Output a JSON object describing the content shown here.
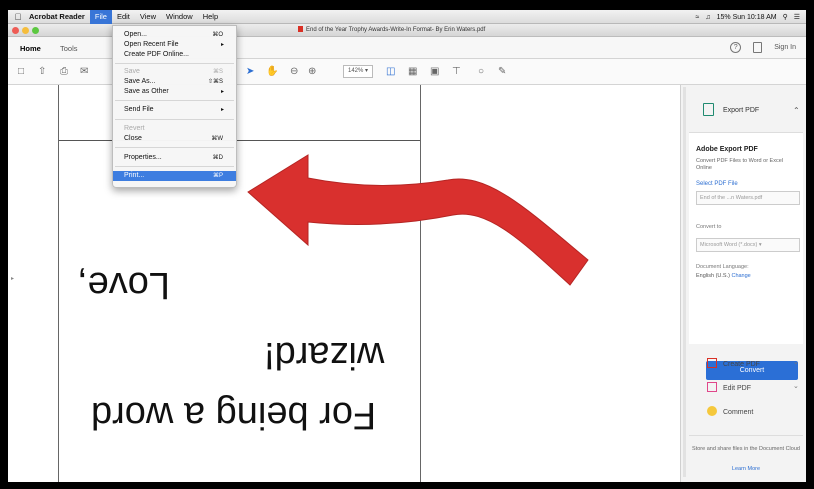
{
  "menubar": {
    "app": "Acrobat Reader",
    "items": [
      "File",
      "Edit",
      "View",
      "Window",
      "Help"
    ],
    "active": "File",
    "status": "15% Sun 10:18 AM"
  },
  "window": {
    "doc_title": "End of the Year Trophy Awards-Write-In Format- By Erin Waters.pdf"
  },
  "app_tabs": {
    "home": "Home",
    "tools": "Tools",
    "help_icon": "?",
    "sign_in": "Sign In"
  },
  "toolbar": {
    "zoom": "142%"
  },
  "file_menu": {
    "items": [
      {
        "label": "Open...",
        "shortcut": "⌘O"
      },
      {
        "label": "Open Recent File",
        "submenu": "▸"
      },
      {
        "label": "Create PDF Online..."
      },
      {
        "label": "Save",
        "shortcut": "⌘S",
        "disabled": true
      },
      {
        "label": "Save As...",
        "shortcut": "⇧⌘S"
      },
      {
        "label": "Save as Other",
        "submenu": "▸"
      },
      {
        "label": "Send File",
        "submenu": "▸"
      },
      {
        "label": "Revert",
        "disabled": true
      },
      {
        "label": "Close",
        "shortcut": "⌘W"
      },
      {
        "label": "Properties...",
        "shortcut": "⌘D"
      },
      {
        "label": "Print...",
        "shortcut": "⌘P",
        "highlighted": true
      }
    ]
  },
  "document": {
    "line1": "Love,",
    "line2": "wizard!",
    "line3": "For being a word"
  },
  "right_panel": {
    "export_header": "Export PDF",
    "card_title": "Adobe Export PDF",
    "card_desc": "Convert PDF Files to Word or Excel Online",
    "select_label": "Select PDF File",
    "file_field": "End of the ...n Waters.pdf",
    "convert_to_label": "Convert to",
    "convert_to_value": "Microsoft Word (*.docx)",
    "doc_lang_label": "Document Language:",
    "doc_lang_value": "English (U.S.)",
    "change_link": "Change",
    "convert_button": "Convert",
    "tools": [
      "Create PDF",
      "Edit PDF",
      "Comment"
    ],
    "cloud_text": "Store and share files in the Document Cloud",
    "learn_more": "Learn More"
  },
  "colors": {
    "accent": "#2b6fd6",
    "menu_highlight": "#3d7de0",
    "arrow": "#d9302e"
  }
}
